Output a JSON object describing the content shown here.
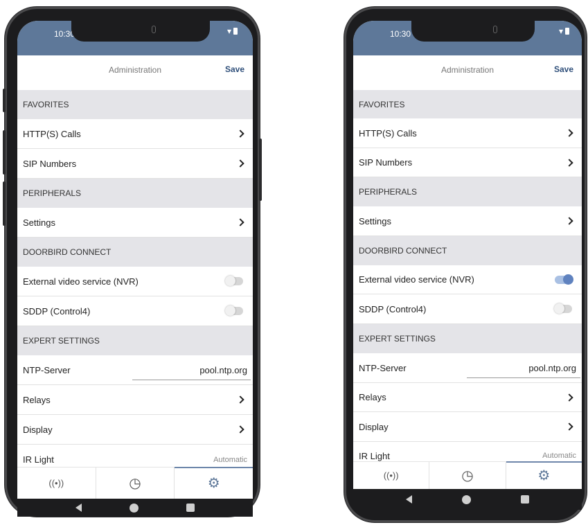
{
  "status": {
    "time": "10:30",
    "signal_glyph": "▾"
  },
  "header": {
    "title": "Administration",
    "save_label": "Save"
  },
  "sections": {
    "favorites": "FAVORITES",
    "peripherals": "PERIPHERALS",
    "doorbird_connect": "DOORBIRD CONNECT",
    "expert_settings": "EXPERT SETTINGS"
  },
  "items": {
    "http_calls": "HTTP(S) Calls",
    "sip_numbers": "SIP Numbers",
    "settings": "Settings",
    "external_video": "External video service (NVR)",
    "sddp": "SDDP (Control4)",
    "ntp_server": "NTP-Server",
    "ntp_value": "pool.ntp.org",
    "relays": "Relays",
    "display": "Display",
    "ir_light": "IR Light",
    "ir_light_value": "Automatic"
  },
  "phones": [
    {
      "external_video_enabled": false,
      "sddp_enabled": false
    },
    {
      "external_video_enabled": true,
      "sddp_enabled": false
    }
  ],
  "tabs": [
    {
      "icon": "broadcast-icon",
      "glyph": "((•))"
    },
    {
      "icon": "history-clock-icon",
      "glyph": "◷"
    },
    {
      "icon": "settings-gear-icon",
      "glyph": "⚙"
    }
  ],
  "colors": {
    "accent": "#5e7899",
    "save_text": "#2f4f7a",
    "section_bg": "#e4e4e8",
    "toggle_on": "#5f82bf"
  }
}
